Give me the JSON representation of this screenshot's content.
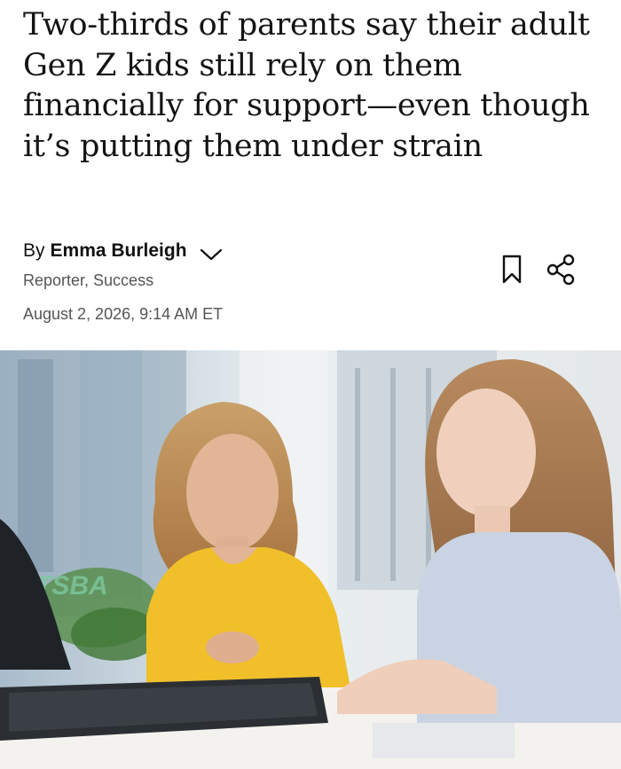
{
  "article": {
    "headline": "Two-thirds of parents say their adult Gen Z kids still rely on them financially for support—even though it’s putting them under strain",
    "byline_prefix": "By",
    "author": "Emma Burleigh",
    "author_role": "Reporter, Success",
    "date": "August 2, 2026, 9:14 AM ET"
  },
  "icons": {
    "author_menu": "chevron-down-icon",
    "save": "bookmark-icon",
    "share": "share-icon"
  },
  "hero_image": {
    "description": "photo",
    "overlay_text": "TSBA"
  },
  "colors": {
    "text": "#141414",
    "muted": "#555555"
  }
}
